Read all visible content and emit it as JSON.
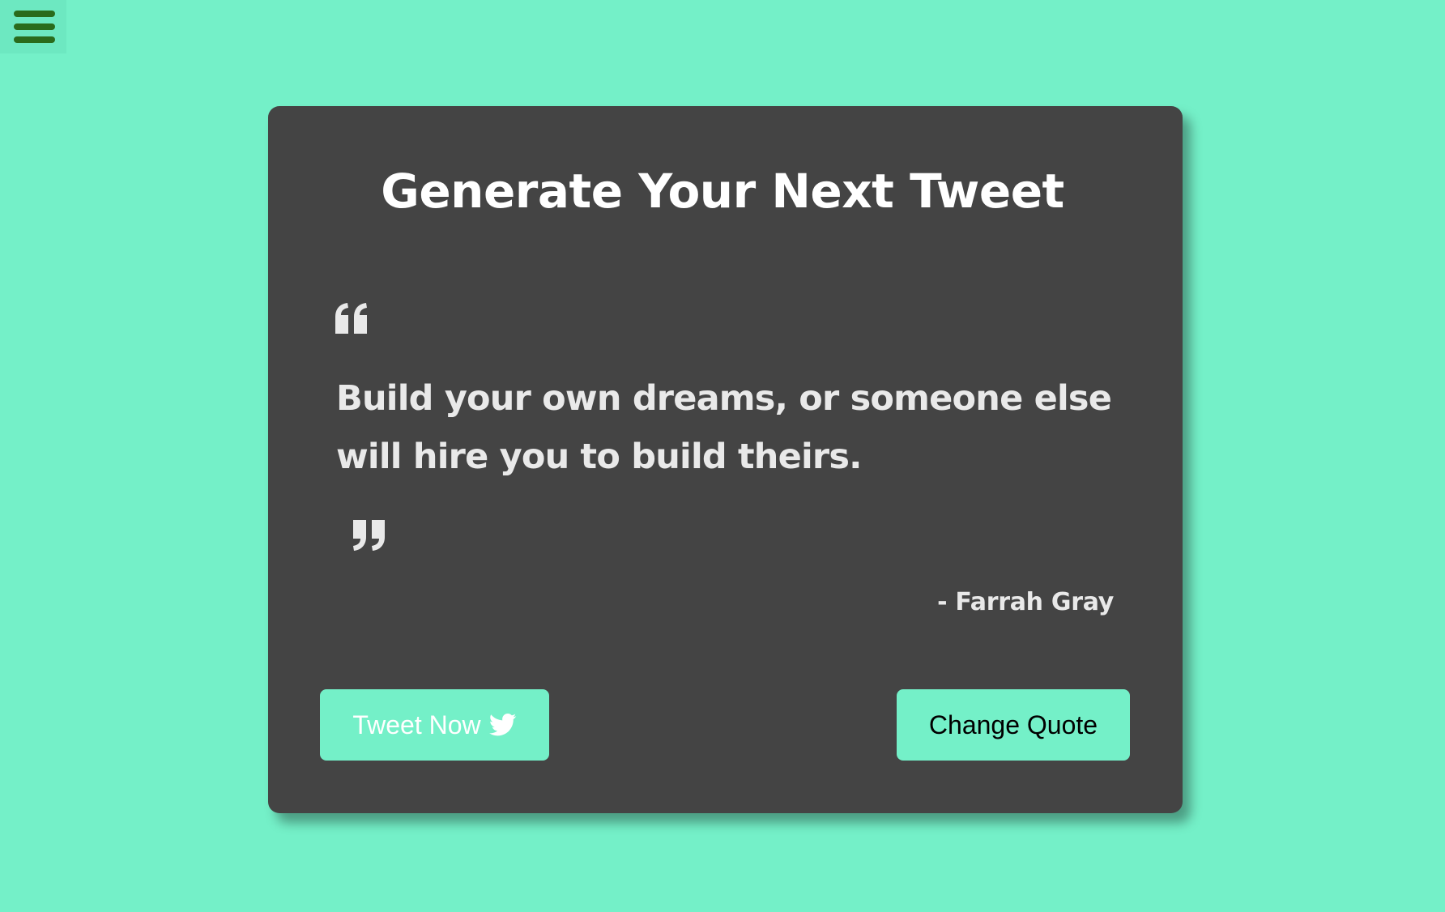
{
  "menu": {
    "icon": "hamburger-menu-icon"
  },
  "card": {
    "title": "Generate Your Next Tweet",
    "quote_open_icon": "quote-open-icon",
    "quote_text": "Build your own dreams, or someone else will hire you to build theirs.",
    "quote_close_icon": "quote-close-icon",
    "author": "- Farrah Gray"
  },
  "actions": {
    "tweet_label": "Tweet Now",
    "tweet_icon": "twitter-bird-icon",
    "change_label": "Change Quote"
  },
  "colors": {
    "background": "#74f0c8",
    "card": "#444444",
    "menu_bars": "#2a6b1c",
    "button_bg": "#74f0c8",
    "text_light": "#e9e9e9"
  }
}
